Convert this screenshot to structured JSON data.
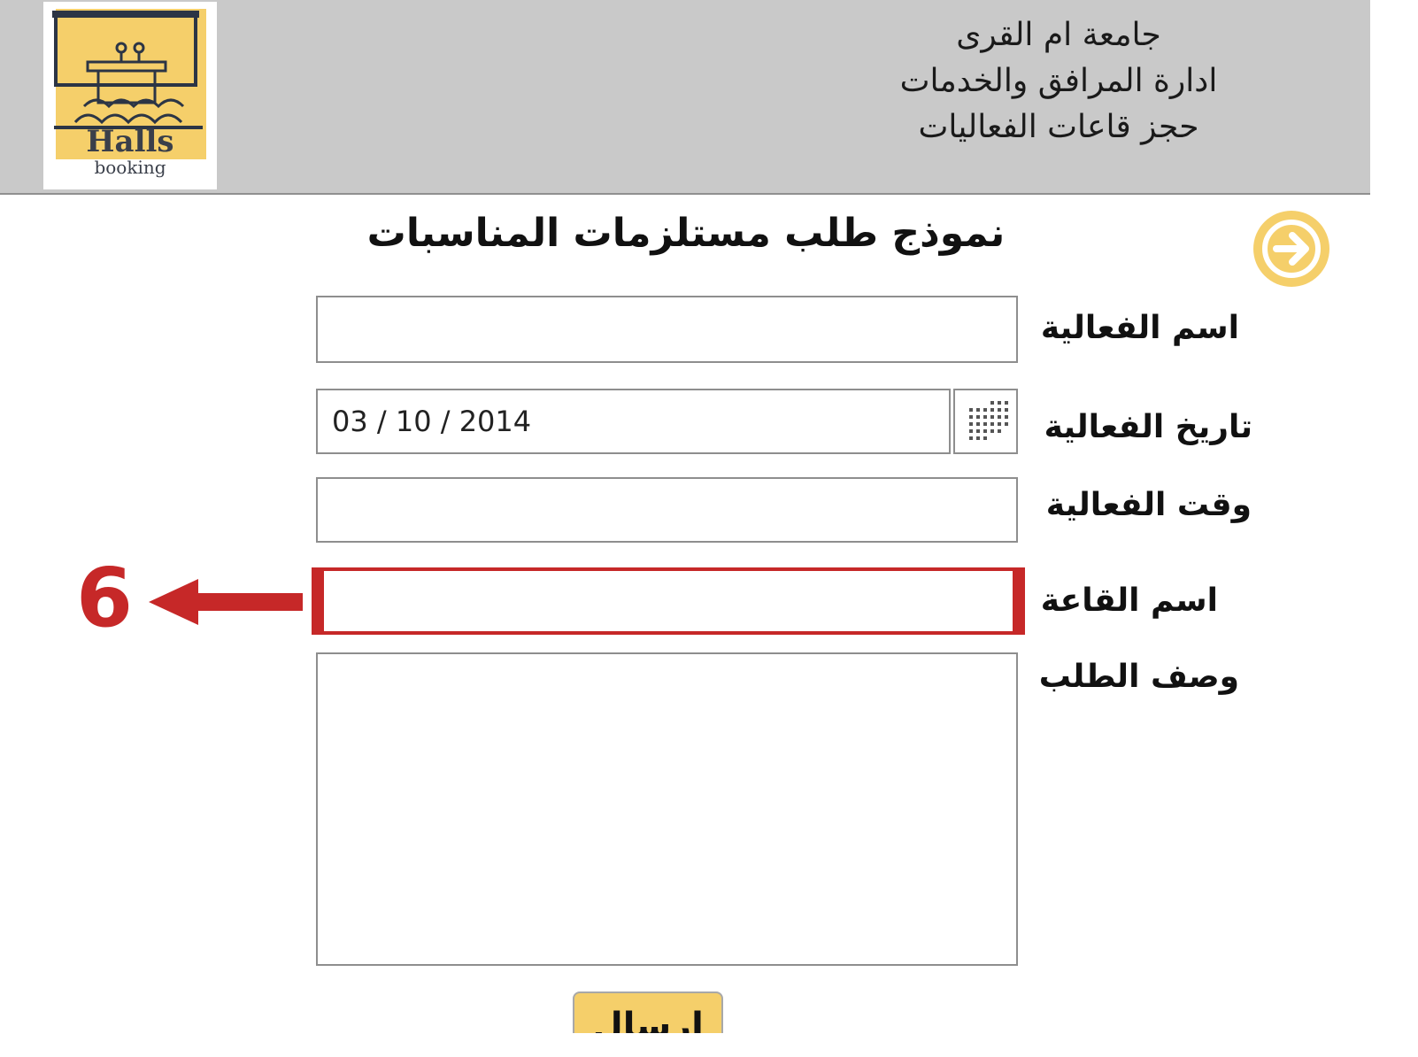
{
  "header": {
    "logo": {
      "title": "Halls",
      "subtitle": "booking"
    },
    "org_lines": [
      "جامعة ام القرى",
      "ادارة المرافق والخدمات",
      "حجز قاعات الفعاليات"
    ]
  },
  "navigation": {
    "next_icon": "arrow-right-circle-icon"
  },
  "form": {
    "title": "نموذج طلب مستلزمات المناسبات",
    "fields": {
      "event_name": {
        "label": "اسم الفعالية",
        "value": ""
      },
      "event_date": {
        "label": "تاريخ الفعالية",
        "value": "03 / 10 / 2014",
        "picker_icon": "calendar-grid-icon"
      },
      "event_time": {
        "label": "وقت الفعالية",
        "value": ""
      },
      "hall_name": {
        "label": "اسم القاعة",
        "value": ""
      },
      "request_description": {
        "label": "وصف الطلب",
        "value": ""
      }
    },
    "submit_label": "إرسال"
  },
  "annotation": {
    "number": "6",
    "color": "#c62828"
  },
  "colors": {
    "header_bg": "#c9c9c9",
    "accent_yellow": "#f5cf6a",
    "highlight_red": "#c62828"
  }
}
